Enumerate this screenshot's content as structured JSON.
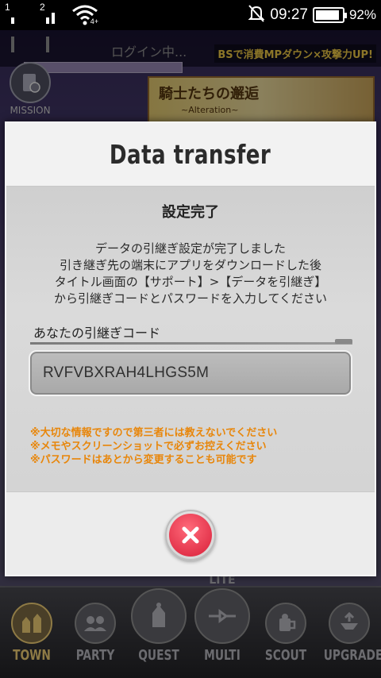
{
  "status_bar": {
    "sim1": "1",
    "sim2": "2",
    "wifi_tag": "4+",
    "time": "09:27",
    "battery_percent": "92%",
    "battery_level": 0.92
  },
  "background": {
    "loading_text": "ログイン中...",
    "ticker": "BSで消費MPダウン×攻撃力UP!",
    "mission_label": "MISSION",
    "banner_title": "騎士たちの邂逅",
    "banner_subtitle": "~Alteration~"
  },
  "dialog": {
    "title": "Data transfer",
    "heading": "設定完了",
    "message_lines": [
      "データの引継ぎ設定が完了しました",
      "引き継ぎ先の端末にアプリをダウンロードした後",
      "タイトル画面の【サポート】>【データを引継ぎ】",
      "から引継ぎコードとパスワードを入力してください"
    ],
    "code_label": "あなたの引継ぎコード",
    "code_value": "RVFVBXRAH4LHGS5M",
    "warnings": [
      "※大切な情報ですので第三者には教えないでください",
      "※メモやスクリーンショットで必ずお控えください",
      "※パスワードはあとから変更することも可能です"
    ],
    "close_icon": "close-x-icon",
    "accent_color": "#d81e38",
    "warning_color": "#e8860a"
  },
  "bottom_nav": {
    "items": [
      {
        "label": "TOWN",
        "icon": "town-icon",
        "active": true
      },
      {
        "label": "PARTY",
        "icon": "party-icon",
        "active": false
      },
      {
        "label": "QUEST",
        "icon": "quest-icon",
        "active": false
      },
      {
        "label": "MULTI",
        "icon": "multi-icon",
        "active": false,
        "badge": "LITE"
      },
      {
        "label": "SCOUT",
        "icon": "scout-icon",
        "active": false
      },
      {
        "label": "UPGRADE",
        "icon": "upgrade-icon",
        "active": false
      }
    ]
  }
}
